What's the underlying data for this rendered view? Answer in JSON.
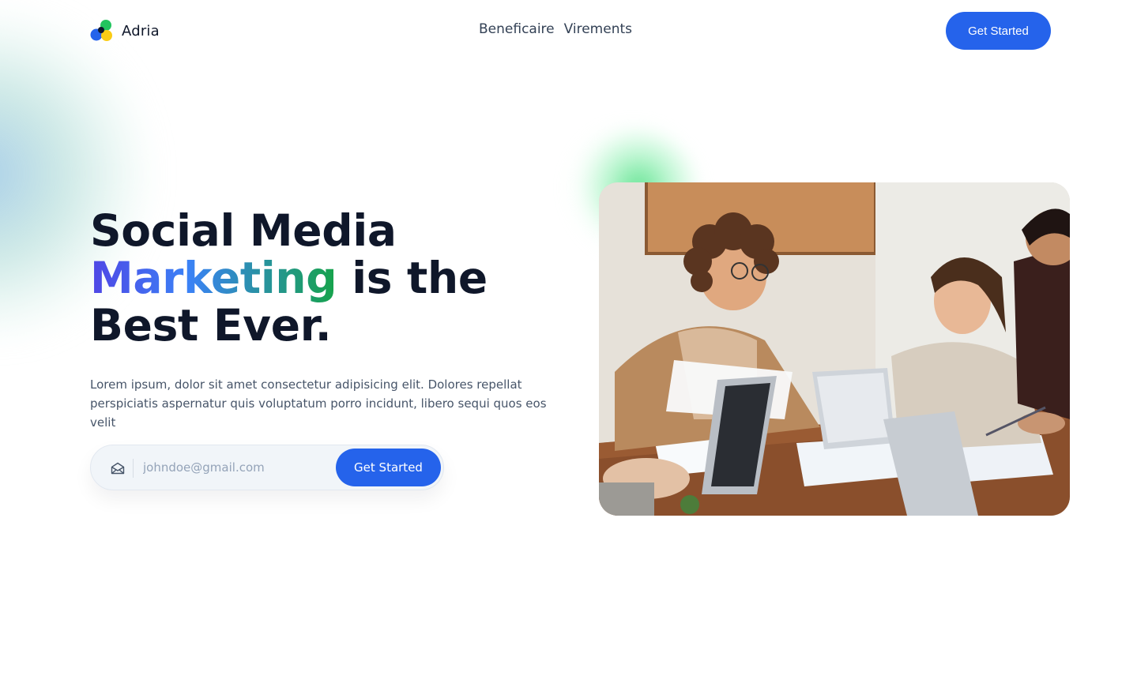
{
  "header": {
    "brand_name": "Adria",
    "nav": [
      {
        "label": "Beneficaire"
      },
      {
        "label": "Virements"
      }
    ],
    "cta_label": "Get Started"
  },
  "hero": {
    "title_line1": "Social Media",
    "title_highlight": "Marketing",
    "title_line2_rest": " is the",
    "title_line3": "Best Ever.",
    "description": "Lorem ipsum, dolor sit amet consectetur adipisicing elit. Dolores repellat perspiciatis aspernatur quis voluptatum porro incidunt, libero sequi quos eos velit",
    "email_placeholder": "johndoe@gmail.com",
    "email_value": "",
    "form_cta_label": "Get Started",
    "image_subject": "office-team-meeting-photo"
  },
  "colors": {
    "primary": "#2563eb",
    "heading": "#0f172a",
    "body_text": "#475569",
    "gradient": [
      "#4f46e5",
      "#3b82f6",
      "#16a34a"
    ]
  },
  "icons": {
    "logo": "adria-logo-icon",
    "email": "envelope-open-icon"
  }
}
